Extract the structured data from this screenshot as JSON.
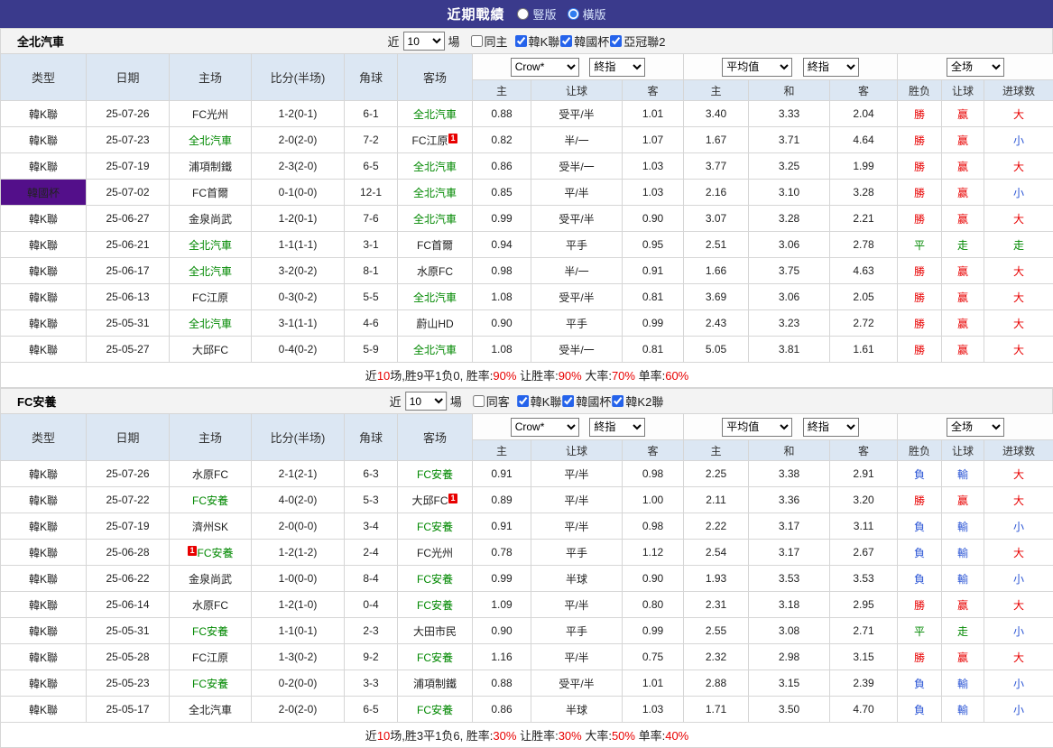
{
  "topbar": {
    "title": "近期戰績",
    "radios": [
      {
        "label": "豎版",
        "selected": false
      },
      {
        "label": "橫版",
        "selected": true
      }
    ]
  },
  "colors": {
    "topbar_bg": "#3a3a8c",
    "league_blue": "#2c68cc",
    "cup_purple": "#530f8a",
    "focus_team_green": "#008800",
    "win_red": "#e80000",
    "lose_blue": "#2b55d5",
    "odds_navy": "#2b3b96"
  },
  "sections": [
    {
      "team": "全北汽車",
      "near_label": "近",
      "games_count": "10",
      "games_label": "場",
      "same_side": {
        "label": "同主",
        "checked": false
      },
      "leagues": [
        {
          "label": "韓K聯",
          "checked": true
        },
        {
          "label": "韓國杯",
          "checked": true
        },
        {
          "label": "亞冠聯2",
          "checked": true
        }
      ],
      "selects": {
        "company": "Crow*",
        "stage1": "終指",
        "average": "平均值",
        "stage2": "終指",
        "scope": "全场"
      },
      "columns": {
        "type": "类型",
        "date": "日期",
        "home": "主场",
        "score": "比分(半场)",
        "corner": "角球",
        "away": "客场",
        "asian": [
          "主",
          "让球",
          "客"
        ],
        "euro": [
          "主",
          "和",
          "客"
        ],
        "result": [
          "胜负",
          "让球",
          "进球数"
        ]
      },
      "rows": [
        {
          "league": "韓K聯",
          "date": "25-07-26",
          "home": "FC光州",
          "score": "1-2(0-1)",
          "corner": "6-1",
          "away": "全北汽車",
          "asian": [
            "0.88",
            "受平/半",
            "1.01"
          ],
          "euro": [
            "3.40",
            "3.33",
            "2.04"
          ],
          "outcome": [
            "勝",
            "赢",
            "大"
          ]
        },
        {
          "league": "韓K聯",
          "date": "25-07-23",
          "home": "全北汽車",
          "score": "2-0(2-0)",
          "corner": "7-2",
          "away": {
            "name": "FC江原",
            "sup": "1"
          },
          "asian": [
            "0.82",
            "半/一",
            "1.07"
          ],
          "euro": [
            "1.67",
            "3.71",
            "4.64"
          ],
          "outcome": [
            "勝",
            "赢",
            "小"
          ]
        },
        {
          "league": "韓K聯",
          "date": "25-07-19",
          "home": "浦項制鐵",
          "score": "2-3(2-0)",
          "corner": "6-5",
          "away": "全北汽車",
          "asian": [
            "0.86",
            "受半/一",
            "1.03"
          ],
          "euro": [
            "3.77",
            "3.25",
            "1.99"
          ],
          "outcome": [
            "勝",
            "赢",
            "大"
          ]
        },
        {
          "league": "韓國杯",
          "date": "25-07-02",
          "home": "FC首爾",
          "score": "0-1(0-0)",
          "corner": "12-1",
          "away": "全北汽車",
          "asian": [
            "0.85",
            "平/半",
            "1.03"
          ],
          "euro": [
            "2.16",
            "3.10",
            "3.28"
          ],
          "outcome": [
            "勝",
            "赢",
            "小"
          ]
        },
        {
          "league": "韓K聯",
          "date": "25-06-27",
          "home": "金泉尚武",
          "score": "1-2(0-1)",
          "corner": "7-6",
          "away": "全北汽車",
          "asian": [
            "0.99",
            "受平/半",
            "0.90"
          ],
          "euro": [
            "3.07",
            "3.28",
            "2.21"
          ],
          "outcome": [
            "勝",
            "赢",
            "大"
          ]
        },
        {
          "league": "韓K聯",
          "date": "25-06-21",
          "home": "全北汽車",
          "score": "1-1(1-1)",
          "corner": "3-1",
          "away": "FC首爾",
          "asian": [
            "0.94",
            "平手",
            "0.95"
          ],
          "euro": [
            "2.51",
            "3.06",
            "2.78"
          ],
          "outcome": [
            "平",
            "走",
            "走"
          ]
        },
        {
          "league": "韓K聯",
          "date": "25-06-17",
          "home": "全北汽車",
          "score": "3-2(0-2)",
          "corner": "8-1",
          "away": "水原FC",
          "asian": [
            "0.98",
            "半/一",
            "0.91"
          ],
          "euro": [
            "1.66",
            "3.75",
            "4.63"
          ],
          "outcome": [
            "勝",
            "赢",
            "大"
          ]
        },
        {
          "league": "韓K聯",
          "date": "25-06-13",
          "home": "FC江原",
          "score": "0-3(0-2)",
          "corner": "5-5",
          "away": "全北汽車",
          "asian": [
            "1.08",
            "受平/半",
            "0.81"
          ],
          "euro": [
            "3.69",
            "3.06",
            "2.05"
          ],
          "outcome": [
            "勝",
            "赢",
            "大"
          ]
        },
        {
          "league": "韓K聯",
          "date": "25-05-31",
          "home": "全北汽車",
          "score": "3-1(1-1)",
          "corner": "4-6",
          "away": "蔚山HD",
          "asian": [
            "0.90",
            "平手",
            "0.99"
          ],
          "euro": [
            "2.43",
            "3.23",
            "2.72"
          ],
          "outcome": [
            "勝",
            "赢",
            "大"
          ]
        },
        {
          "league": "韓K聯",
          "date": "25-05-27",
          "home": "大邱FC",
          "score": "0-4(0-2)",
          "corner": "5-9",
          "away": "全北汽車",
          "asian": [
            "1.08",
            "受半/一",
            "0.81"
          ],
          "euro": [
            "5.05",
            "3.81",
            "1.61"
          ],
          "outcome": [
            "勝",
            "赢",
            "大"
          ]
        }
      ],
      "summary": [
        {
          "t": "近",
          "r": false
        },
        {
          "t": "10",
          "r": true
        },
        {
          "t": "场,胜9平1负0, 胜率:",
          "r": false
        },
        {
          "t": "90%",
          "r": true
        },
        {
          "t": " 让胜率:",
          "r": false
        },
        {
          "t": "90%",
          "r": true
        },
        {
          "t": " 大率:",
          "r": false
        },
        {
          "t": "70%",
          "r": true
        },
        {
          "t": " 单率:",
          "r": false
        },
        {
          "t": "60%",
          "r": true
        }
      ]
    },
    {
      "team": "FC安養",
      "near_label": "近",
      "games_count": "10",
      "games_label": "場",
      "same_side": {
        "label": "同客",
        "checked": false
      },
      "leagues": [
        {
          "label": "韓K聯",
          "checked": true
        },
        {
          "label": "韓國杯",
          "checked": true
        },
        {
          "label": "韓K2聯",
          "checked": true
        }
      ],
      "selects": {
        "company": "Crow*",
        "stage1": "終指",
        "average": "平均值",
        "stage2": "終指",
        "scope": "全场"
      },
      "columns": {
        "type": "类型",
        "date": "日期",
        "home": "主场",
        "score": "比分(半场)",
        "corner": "角球",
        "away": "客场",
        "asian": [
          "主",
          "让球",
          "客"
        ],
        "euro": [
          "主",
          "和",
          "客"
        ],
        "result": [
          "胜负",
          "让球",
          "进球数"
        ]
      },
      "rows": [
        {
          "league": "韓K聯",
          "date": "25-07-26",
          "home": "水原FC",
          "score": "2-1(2-1)",
          "corner": "6-3",
          "away": "FC安養",
          "asian": [
            "0.91",
            "平/半",
            "0.98"
          ],
          "euro": [
            "2.25",
            "3.38",
            "2.91"
          ],
          "outcome": [
            "負",
            "輸",
            "大"
          ]
        },
        {
          "league": "韓K聯",
          "date": "25-07-22",
          "home": "FC安養",
          "score": "4-0(2-0)",
          "corner": "5-3",
          "away": {
            "name": "大邱FC",
            "sup": "1"
          },
          "asian": [
            "0.89",
            "平/半",
            "1.00"
          ],
          "euro": [
            "2.11",
            "3.36",
            "3.20"
          ],
          "outcome": [
            "勝",
            "赢",
            "大"
          ]
        },
        {
          "league": "韓K聯",
          "date": "25-07-19",
          "home": "濟州SK",
          "score": "2-0(0-0)",
          "corner": "3-4",
          "away": "FC安養",
          "asian": [
            "0.91",
            "平/半",
            "0.98"
          ],
          "euro": [
            "2.22",
            "3.17",
            "3.11"
          ],
          "outcome": [
            "負",
            "輸",
            "小"
          ]
        },
        {
          "league": "韓K聯",
          "date": "25-06-28",
          "home": {
            "name": "FC安養",
            "pre": "1"
          },
          "score": "1-2(1-2)",
          "corner": "2-4",
          "away": "FC光州",
          "asian": [
            "0.78",
            "平手",
            "1.12"
          ],
          "euro": [
            "2.54",
            "3.17",
            "2.67"
          ],
          "outcome": [
            "負",
            "輸",
            "大"
          ]
        },
        {
          "league": "韓K聯",
          "date": "25-06-22",
          "home": "金泉尚武",
          "score": "1-0(0-0)",
          "corner": "8-4",
          "away": "FC安養",
          "asian": [
            "0.99",
            "半球",
            "0.90"
          ],
          "euro": [
            "1.93",
            "3.53",
            "3.53"
          ],
          "outcome": [
            "負",
            "輸",
            "小"
          ]
        },
        {
          "league": "韓K聯",
          "date": "25-06-14",
          "home": "水原FC",
          "score": "1-2(1-0)",
          "corner": "0-4",
          "away": "FC安養",
          "asian": [
            "1.09",
            "平/半",
            "0.80"
          ],
          "euro": [
            "2.31",
            "3.18",
            "2.95"
          ],
          "outcome": [
            "勝",
            "赢",
            "大"
          ]
        },
        {
          "league": "韓K聯",
          "date": "25-05-31",
          "home": "FC安養",
          "score": "1-1(0-1)",
          "corner": "2-3",
          "away": "大田市民",
          "asian": [
            "0.90",
            "平手",
            "0.99"
          ],
          "euro": [
            "2.55",
            "3.08",
            "2.71"
          ],
          "outcome": [
            "平",
            "走",
            "小"
          ]
        },
        {
          "league": "韓K聯",
          "date": "25-05-28",
          "home": "FC江原",
          "score": "1-3(0-2)",
          "corner": "9-2",
          "away": "FC安養",
          "asian": [
            "1.16",
            "平/半",
            "0.75"
          ],
          "euro": [
            "2.32",
            "2.98",
            "3.15"
          ],
          "outcome": [
            "勝",
            "赢",
            "大"
          ]
        },
        {
          "league": "韓K聯",
          "date": "25-05-23",
          "home": "FC安養",
          "score": "0-2(0-0)",
          "corner": "3-3",
          "away": "浦項制鐵",
          "asian": [
            "0.88",
            "受平/半",
            "1.01"
          ],
          "euro": [
            "2.88",
            "3.15",
            "2.39"
          ],
          "outcome": [
            "負",
            "輸",
            "小"
          ]
        },
        {
          "league": "韓K聯",
          "date": "25-05-17",
          "home": "全北汽車",
          "score": "2-0(2-0)",
          "corner": "6-5",
          "away": "FC安養",
          "asian": [
            "0.86",
            "半球",
            "1.03"
          ],
          "euro": [
            "1.71",
            "3.50",
            "4.70"
          ],
          "outcome": [
            "負",
            "輸",
            "小"
          ]
        }
      ],
      "summary": [
        {
          "t": "近",
          "r": false
        },
        {
          "t": "10",
          "r": true
        },
        {
          "t": "场,胜3平1负6, 胜率:",
          "r": false
        },
        {
          "t": "30%",
          "r": true
        },
        {
          "t": " 让胜率:",
          "r": false
        },
        {
          "t": "30%",
          "r": true
        },
        {
          "t": " 大率:",
          "r": false
        },
        {
          "t": "50%",
          "r": true
        },
        {
          "t": " 单率:",
          "r": false
        },
        {
          "t": "40%",
          "r": true
        }
      ]
    }
  ]
}
